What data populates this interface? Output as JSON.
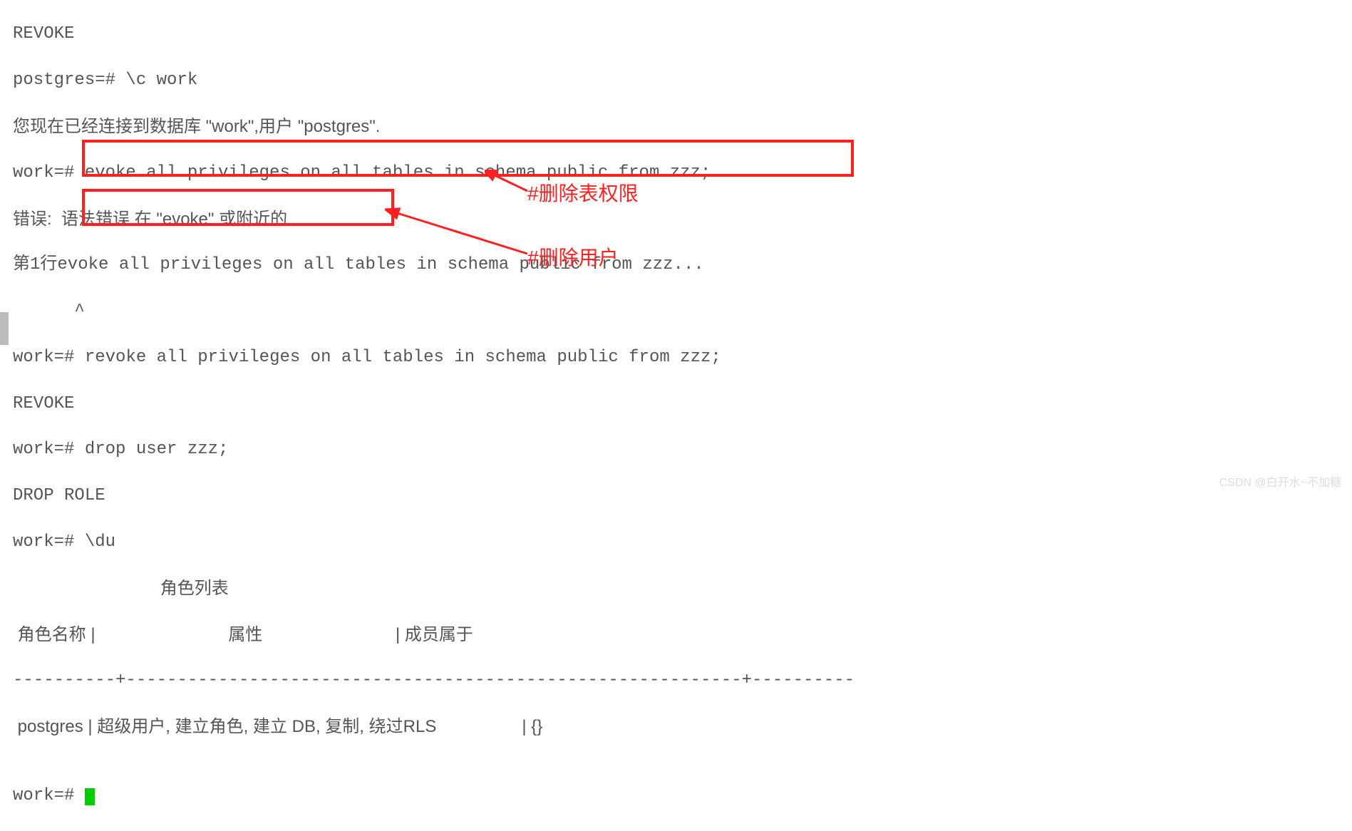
{
  "terminal": {
    "l0": "REVOKE",
    "l1": "postgres=# \\c work",
    "l2": "您现在已经连接到数据库 \"work\",用户 \"postgres\".",
    "l3": "work=# evoke all privileges on all tables in schema public from zzz;",
    "l4": "错误:  语法错误 在 \"evoke\" 或附近的",
    "l5": "第1行evoke all privileges on all tables in schema public from zzz...",
    "l6": "      ^",
    "l7_prompt": "work=# ",
    "l7_cmd": "revoke all privileges on all tables in schema public from zzz;",
    "l8": "REVOKE",
    "l9_prompt": "work=# ",
    "l9_cmd": "drop user zzz;",
    "l10": "DROP ROLE",
    "l11": "work=# \\du",
    "table_title": "                               角色列表",
    "table_header": " 角色名称 |                            属性                            | 成员属于",
    "table_sep": "----------+------------------------------------------------------------+----------",
    "table_row1": " postgres | 超级用户, 建立角色, 建立 DB, 复制, 绕过RLS                  | {}",
    "l_blank": "",
    "l_final": "work=# "
  },
  "annotations": {
    "revoke_label": "#删除表权限",
    "dropuser_label": "#删除用户"
  },
  "watermark": "CSDN @白开水~不加糖"
}
